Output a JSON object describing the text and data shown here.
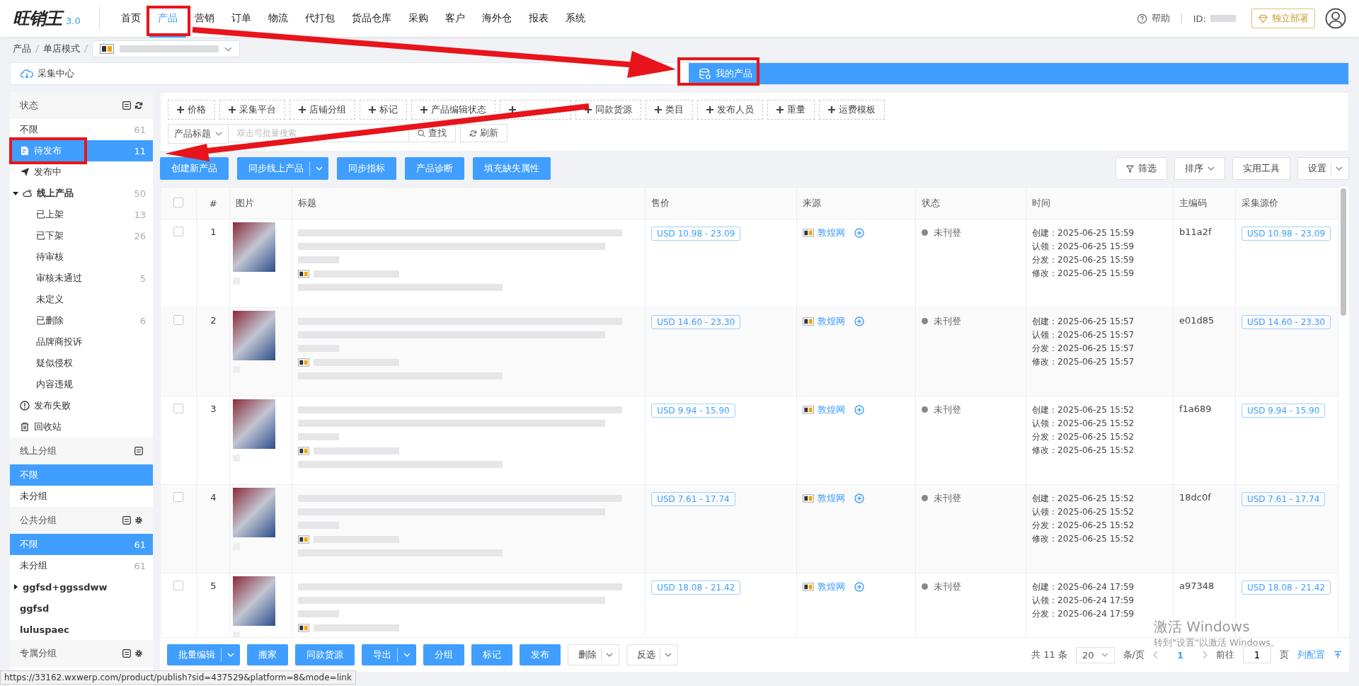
{
  "header": {
    "logo": "旺销王",
    "version": "3.0",
    "nav": [
      {
        "label": "首页",
        "selected": false
      },
      {
        "label": "产品",
        "selected": true
      },
      {
        "label": "营销",
        "selected": false
      },
      {
        "label": "订单",
        "selected": false
      },
      {
        "label": "物流",
        "selected": false
      },
      {
        "label": "代打包",
        "selected": false
      },
      {
        "label": "货品仓库",
        "selected": false
      },
      {
        "label": "采购",
        "selected": false
      },
      {
        "label": "客户",
        "selected": false
      },
      {
        "label": "海外仓",
        "selected": false
      },
      {
        "label": "报表",
        "selected": false
      },
      {
        "label": "系统",
        "selected": false
      }
    ],
    "help": "帮助",
    "id_label": "ID:",
    "deploy": "独立部署"
  },
  "breadcrumb": [
    "产品",
    "单店模式"
  ],
  "tabs": [
    {
      "label": "采集中心",
      "selected": false
    },
    {
      "label": "我的产品",
      "selected": true
    }
  ],
  "status_panel": {
    "title": "状态",
    "items": [
      {
        "kind": "plain",
        "label": "不限",
        "count": "61",
        "selected": false
      },
      {
        "kind": "draft",
        "label": "待发布",
        "count": "11",
        "selected": true
      },
      {
        "kind": "publishing",
        "label": "发布中",
        "selected": false
      },
      {
        "kind": "online",
        "label": "线上产品",
        "count": "50",
        "selected": false,
        "expanded": true,
        "children": [
          {
            "label": "已上架",
            "count": "13",
            "selected": false
          },
          {
            "label": "已下架",
            "count": "26",
            "selected": false
          },
          {
            "label": "待审核",
            "selected": false
          },
          {
            "label": "审核未通过",
            "count": "5",
            "selected": false
          },
          {
            "label": "未定义",
            "selected": false
          },
          {
            "label": "已删除",
            "count": "6",
            "selected": false
          },
          {
            "label": "品牌商投诉",
            "selected": false
          },
          {
            "label": "疑似侵权",
            "selected": false
          },
          {
            "label": "内容违规",
            "selected": false
          }
        ]
      },
      {
        "kind": "failed",
        "label": "发布失败",
        "selected": false
      },
      {
        "kind": "recycle",
        "label": "回收站",
        "selected": false
      }
    ]
  },
  "groups": [
    {
      "title": "线上分组",
      "settings": false,
      "items": [
        {
          "label": "不限",
          "selected": true
        },
        {
          "label": "未分组",
          "selected": false
        }
      ]
    },
    {
      "title": "公共分组",
      "settings": true,
      "items": [
        {
          "label": "不限",
          "count": "61",
          "selected": true
        },
        {
          "label": "未分组",
          "count": "61",
          "selected": false
        },
        {
          "label": "ggfsd+ggssdww",
          "selected": false,
          "expanded": false,
          "bold": true
        },
        {
          "label": "ggfsd",
          "selected": false,
          "bold": true
        },
        {
          "label": "luluspaec",
          "selected": false,
          "bold": true
        }
      ]
    },
    {
      "title": "专属分组",
      "settings": true
    }
  ],
  "filters": [
    {
      "label": "价格"
    },
    {
      "label": "采集平台"
    },
    {
      "label": "店铺分组"
    },
    {
      "label": "标记"
    },
    {
      "label": "产品编辑状态"
    },
    {
      "hidden": true
    },
    {
      "label": "同款货源"
    },
    {
      "label": "类目"
    },
    {
      "label": "发布人员"
    },
    {
      "label": "重量"
    },
    {
      "label": "运费模板"
    }
  ],
  "search": {
    "field": "产品标题",
    "placeholder": "双击可批量搜索",
    "find": "查找",
    "refresh": "刷新"
  },
  "actions": [
    {
      "label": "创建新产品",
      "split": false
    },
    {
      "label": "同步线上产品",
      "split": true
    },
    {
      "label": "同步指标",
      "split": false
    },
    {
      "label": "产品诊断",
      "split": false
    },
    {
      "label": "填充缺失属性",
      "split": false
    }
  ],
  "tools": [
    {
      "label": "筛选",
      "kind": "filter"
    },
    {
      "label": "排序",
      "kind": "dropdown"
    },
    {
      "label": "实用工具",
      "kind": "plain"
    },
    {
      "label": "设置",
      "kind": "split"
    }
  ],
  "table": {
    "all_checked": false,
    "columns": [
      "#",
      "图片",
      "标题",
      "售价",
      "来源",
      "状态",
      "时间",
      "主编码",
      "采集源价"
    ],
    "rows": [
      {
        "index": "1",
        "price": "USD 10.98 - 23.09",
        "source": "敦煌网",
        "status": "未刊登",
        "times": [
          [
            "创建：",
            "2025-06-25 15:59"
          ],
          [
            "认领：",
            "2025-06-25 15:59"
          ],
          [
            "分发：",
            "2025-06-25 15:59"
          ],
          [
            "修改：",
            "2025-06-25 15:59"
          ]
        ],
        "code": "b11a2f",
        "source_price": "USD 10.98 - 23.09",
        "checked": false
      },
      {
        "index": "2",
        "price": "USD 14.60 - 23.30",
        "source": "敦煌网",
        "status": "未刊登",
        "times": [
          [
            "创建：",
            "2025-06-25 15:57"
          ],
          [
            "认领：",
            "2025-06-25 15:57"
          ],
          [
            "分发：",
            "2025-06-25 15:57"
          ],
          [
            "修改：",
            "2025-06-25 15:57"
          ]
        ],
        "code": "e01d85",
        "source_price": "USD 14.60 - 23.30",
        "checked": false
      },
      {
        "index": "3",
        "price": "USD 9.94 - 15.90",
        "source": "敦煌网",
        "status": "未刊登",
        "times": [
          [
            "创建：",
            "2025-06-25 15:52"
          ],
          [
            "认领：",
            "2025-06-25 15:52"
          ],
          [
            "分发：",
            "2025-06-25 15:52"
          ],
          [
            "修改：",
            "2025-06-25 15:52"
          ]
        ],
        "code": "f1a689",
        "source_price": "USD 9.94 - 15.90",
        "checked": false
      },
      {
        "index": "4",
        "price": "USD 7.61 - 17.74",
        "source": "敦煌网",
        "status": "未刊登",
        "times": [
          [
            "创建：",
            "2025-06-25 15:52"
          ],
          [
            "认领：",
            "2025-06-25 15:52"
          ],
          [
            "分发：",
            "2025-06-25 15:52"
          ],
          [
            "修改：",
            "2025-06-25 15:52"
          ]
        ],
        "code": "18dc0f",
        "source_price": "USD 7.61 - 17.74",
        "checked": false
      },
      {
        "index": "5",
        "price": "USD 18.08 - 21.42",
        "source": "敦煌网",
        "status": "未刊登",
        "times": [
          [
            "创建：",
            "2025-06-24 17:59"
          ],
          [
            "认领：",
            "2025-06-24 17:59"
          ],
          [
            "分发：",
            "2025-06-24 17:59"
          ]
        ],
        "code": "a97348",
        "source_price": "USD 18.08 - 21.42",
        "checked": false
      }
    ]
  },
  "bottom_actions": [
    {
      "label": "批量编辑",
      "kind": "split"
    },
    {
      "label": "搬家",
      "kind": "primary"
    },
    {
      "label": "同款货源",
      "kind": "primary"
    },
    {
      "label": "导出",
      "kind": "split"
    },
    {
      "label": "分组",
      "kind": "primary"
    },
    {
      "label": "标记",
      "kind": "primary"
    },
    {
      "label": "发布",
      "kind": "primary"
    },
    {
      "label": "删除",
      "kind": "plain-split"
    },
    {
      "label": "反选",
      "kind": "plain-split"
    }
  ],
  "pagination": {
    "total": "共 11 条",
    "page_size": "20",
    "per_page": "条/页",
    "current": "1",
    "goto": "前往",
    "goto_value": "1",
    "page": "页",
    "columns": "列配置"
  },
  "status_url": "https://33162.wxwerp.com/product/publish?sid=437529&platform=8&mode=link",
  "os_notice": {
    "title": "激活 Windows",
    "text": "转到\"设置\"以激活 Windows。"
  }
}
